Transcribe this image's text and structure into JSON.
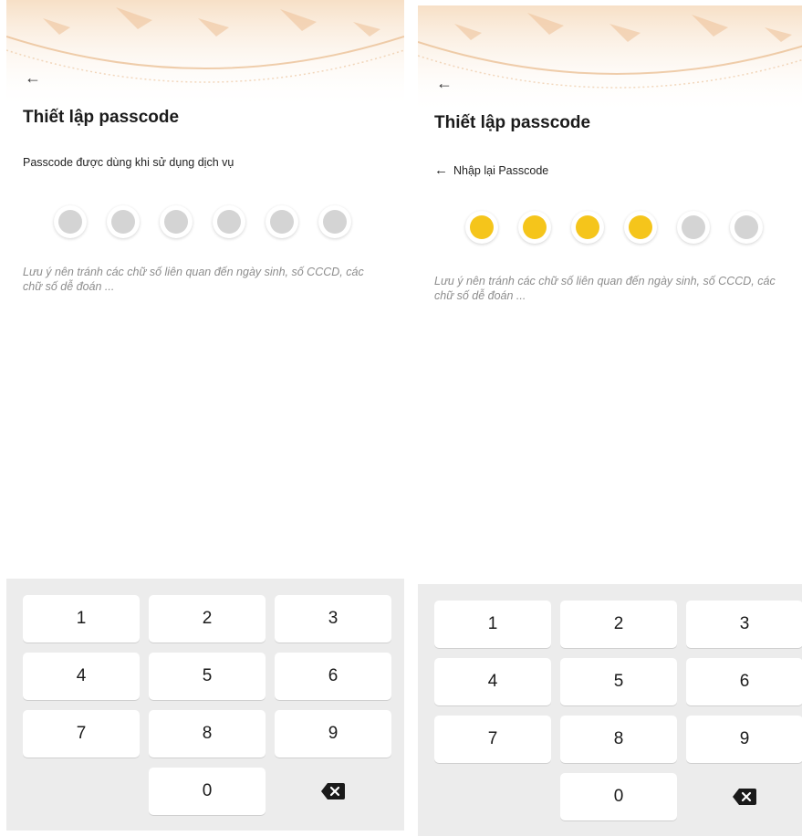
{
  "screens": [
    {
      "title": "Thiết lập passcode",
      "subtitle": "Passcode được dùng khi sử dụng dịch vụ",
      "note": "Lưu ý nên tránh các chữ số liên quan đến ngày sinh, số CCCD, các chữ số dễ đoán ...",
      "passcode_length": 6,
      "filled_count": 0
    },
    {
      "title": "Thiết lập passcode",
      "reenter_label": "Nhập lại Passcode",
      "note": "Lưu ý nên tránh các chữ số liên quan đến ngày sinh, số CCCD, các chữ số dễ đoán ...",
      "passcode_length": 6,
      "filled_count": 4
    }
  ],
  "keypad": {
    "keys": [
      "1",
      "2",
      "3",
      "4",
      "5",
      "6",
      "7",
      "8",
      "9",
      "0"
    ],
    "delete_icon": "backspace-icon"
  },
  "colors": {
    "dot_filled": "#f5c51b",
    "dot_empty": "#d4d4d4",
    "keypad_bg": "#ececec",
    "banner_ornament": "#f0c9a0"
  },
  "icons": {
    "back": "arrow-left-icon"
  }
}
